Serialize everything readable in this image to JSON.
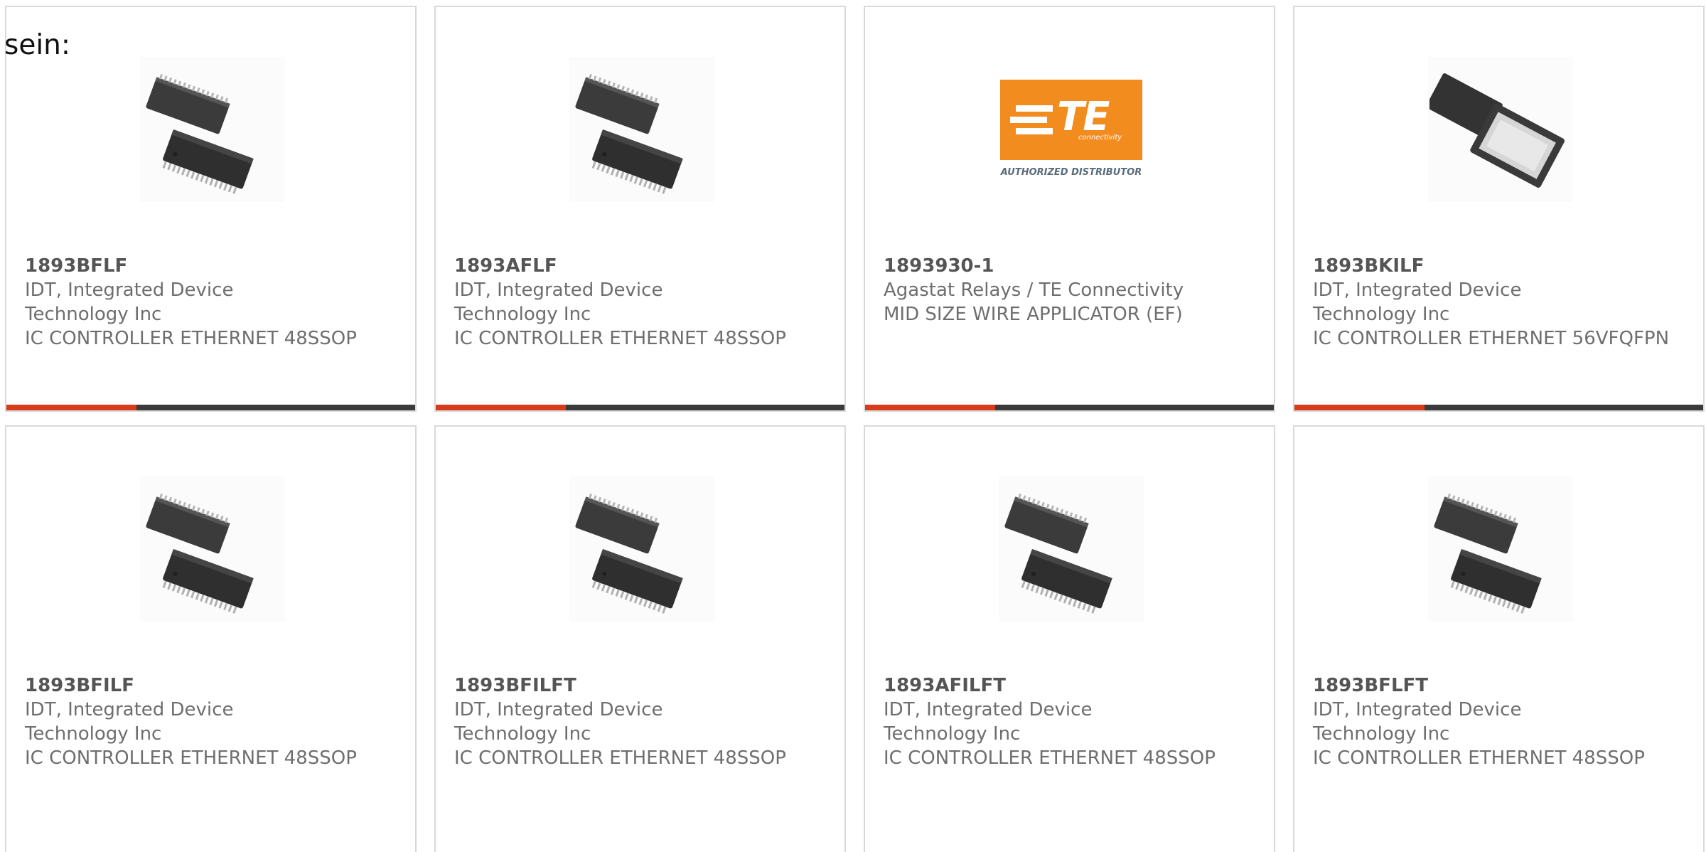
{
  "lead_text": "sein:",
  "colors": {
    "accent": "#d83b1a",
    "bar": "#3a3a3a",
    "card_border": "#d9d9d9",
    "te_orange": "#f28c1e"
  },
  "logo": {
    "te_letters": "TE",
    "te_connectivity": "connectivity",
    "te_authorized": "AUTHORIZED DISTRIBUTOR"
  },
  "products": [
    {
      "part": "1893BFLF",
      "manufacturer": "IDT, Integrated Device Technology Inc",
      "description": "IC CONTROLLER ETHERNET 48SSOP",
      "image": "ssop-chip-icon"
    },
    {
      "part": "1893AFLF",
      "manufacturer": "IDT, Integrated Device Technology Inc",
      "description": "IC CONTROLLER ETHERNET 48SSOP",
      "image": "ssop-chip-icon"
    },
    {
      "part": "1893930-1",
      "manufacturer": "Agastat Relays / TE Connectivity",
      "description": "MID SIZE WIRE APPLICATOR (EF)",
      "image": "te-logo"
    },
    {
      "part": "1893BKILF",
      "manufacturer": "IDT, Integrated Device Technology Inc",
      "description": "IC CONTROLLER ETHERNET 56VFQFPN",
      "image": "qfn-chip-icon"
    },
    {
      "part": "1893BFILF",
      "manufacturer": "IDT, Integrated Device Technology Inc",
      "description": "IC CONTROLLER ETHERNET 48SSOP",
      "image": "ssop-chip-icon"
    },
    {
      "part": "1893BFILFT",
      "manufacturer": "IDT, Integrated Device Technology Inc",
      "description": "IC CONTROLLER ETHERNET 48SSOP",
      "image": "ssop-chip-icon"
    },
    {
      "part": "1893AFILFT",
      "manufacturer": "IDT, Integrated Device Technology Inc",
      "description": "IC CONTROLLER ETHERNET 48SSOP",
      "image": "ssop-chip-icon"
    },
    {
      "part": "1893BFLFT",
      "manufacturer": "IDT, Integrated Device Technology Inc",
      "description": "IC CONTROLLER ETHERNET 48SSOP",
      "image": "ssop-chip-icon"
    }
  ]
}
